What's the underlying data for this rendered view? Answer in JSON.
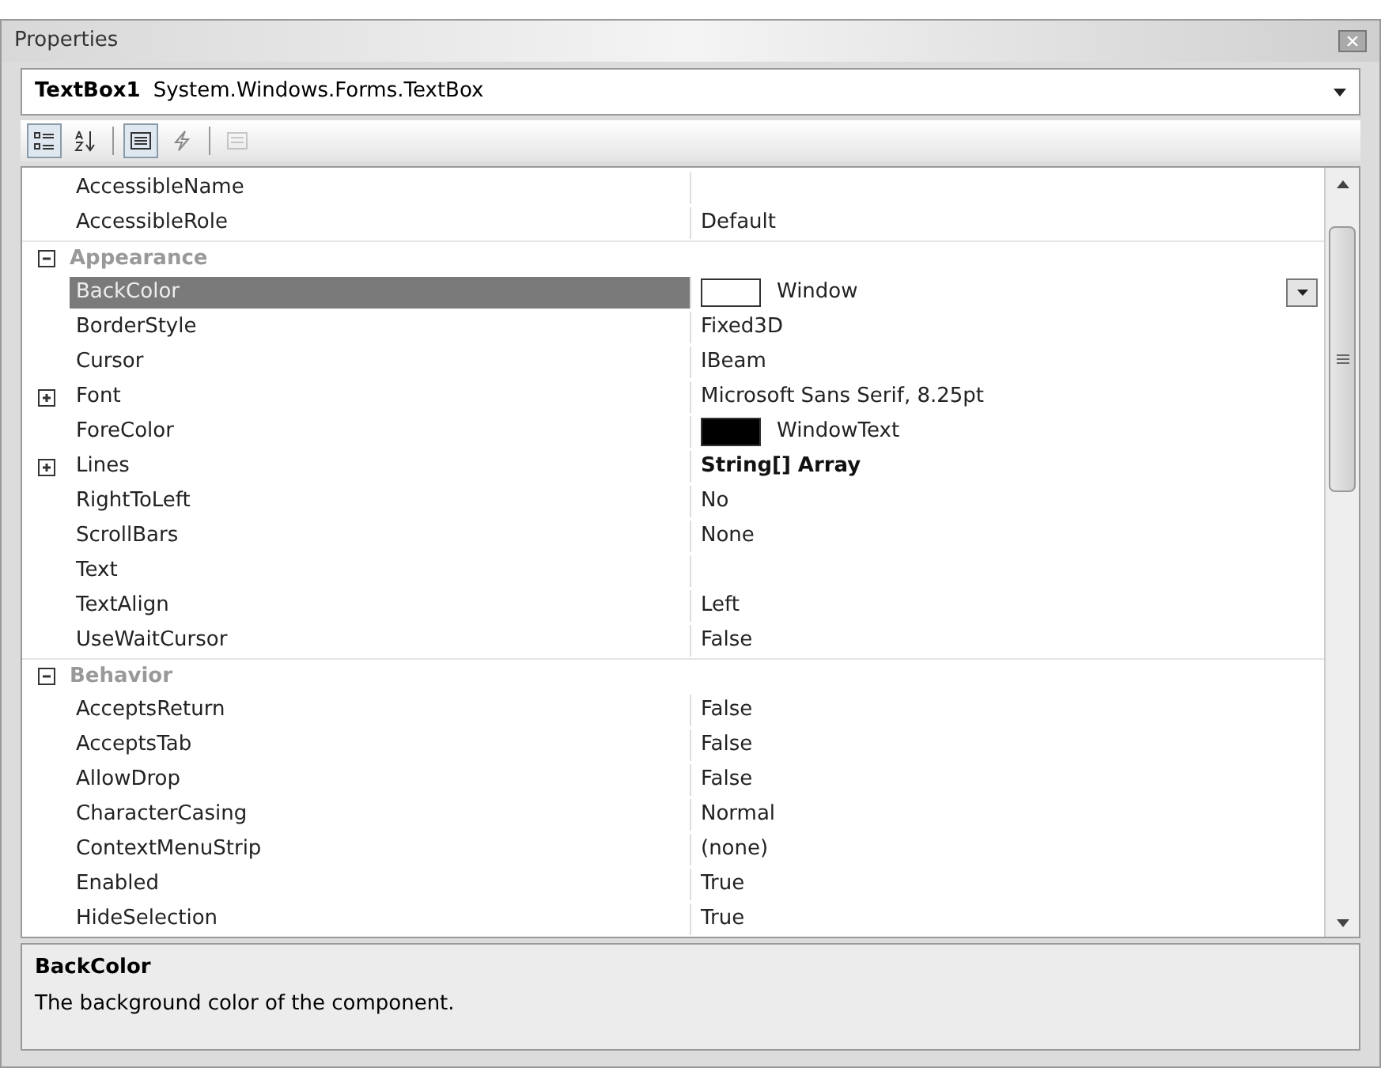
{
  "window": {
    "title": "Properties"
  },
  "object_selector": {
    "name": "TextBox1",
    "type": "System.Windows.Forms.TextBox"
  },
  "toolbar": [
    {
      "kind": "categorized",
      "selected": true,
      "disabled": false
    },
    {
      "kind": "alphabetical",
      "selected": false,
      "disabled": false
    },
    {
      "kind": "properties",
      "selected": true,
      "disabled": false
    },
    {
      "kind": "events",
      "selected": false,
      "disabled": false
    },
    {
      "kind": "property-pages",
      "selected": false,
      "disabled": true
    }
  ],
  "grid": {
    "rows": [
      {
        "kind": "property",
        "name": "AccessibleName",
        "value": "",
        "selected": false
      },
      {
        "kind": "property",
        "name": "AccessibleRole",
        "value": "Default",
        "selected": false
      },
      {
        "kind": "category",
        "name": "Appearance",
        "expanded": true
      },
      {
        "kind": "property",
        "name": "BackColor",
        "value": "Window",
        "selected": true,
        "color": "#ffffff"
      },
      {
        "kind": "property",
        "name": "BorderStyle",
        "value": "Fixed3D",
        "selected": false
      },
      {
        "kind": "property",
        "name": "Cursor",
        "value": "IBeam",
        "selected": false
      },
      {
        "kind": "property",
        "name": "Font",
        "value": "Microsoft Sans Serif, 8.25pt",
        "selected": false,
        "expanded": false
      },
      {
        "kind": "property",
        "name": "ForeColor",
        "value": "WindowText",
        "selected": false,
        "color": "#000000"
      },
      {
        "kind": "property",
        "name": "Lines",
        "value": "String[] Array",
        "selected": false,
        "bold": true,
        "expanded": false
      },
      {
        "kind": "property",
        "name": "RightToLeft",
        "value": "No",
        "selected": false
      },
      {
        "kind": "property",
        "name": "ScrollBars",
        "value": "None",
        "selected": false
      },
      {
        "kind": "property",
        "name": "Text",
        "value": "",
        "selected": false
      },
      {
        "kind": "property",
        "name": "TextAlign",
        "value": "Left",
        "selected": false
      },
      {
        "kind": "property",
        "name": "UseWaitCursor",
        "value": "False",
        "selected": false
      },
      {
        "kind": "category",
        "name": "Behavior",
        "expanded": true
      },
      {
        "kind": "property",
        "name": "AcceptsReturn",
        "value": "False",
        "selected": false
      },
      {
        "kind": "property",
        "name": "AcceptsTab",
        "value": "False",
        "selected": false
      },
      {
        "kind": "property",
        "name": "AllowDrop",
        "value": "False",
        "selected": false
      },
      {
        "kind": "property",
        "name": "CharacterCasing",
        "value": "Normal",
        "selected": false
      },
      {
        "kind": "property",
        "name": "ContextMenuStrip",
        "value": "(none)",
        "selected": false
      },
      {
        "kind": "property",
        "name": "Enabled",
        "value": "True",
        "selected": false
      },
      {
        "kind": "property",
        "name": "HideSelection",
        "value": "True",
        "selected": false
      }
    ]
  },
  "description": {
    "title": "BackColor",
    "text": "The background color of the component."
  }
}
